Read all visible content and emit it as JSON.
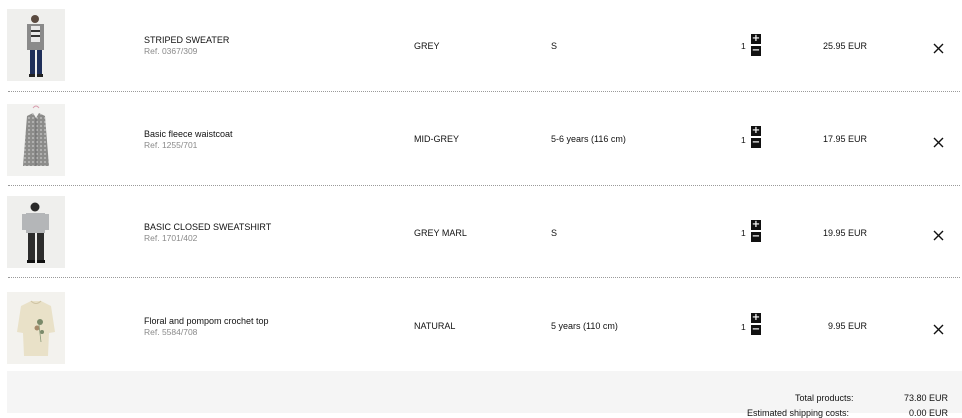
{
  "cart": {
    "items": [
      {
        "name": "STRIPED SWEATER",
        "ref": "Ref. 0367/309",
        "color": "GREY",
        "size": "S",
        "quantity": "1",
        "price": "25.95 EUR"
      },
      {
        "name": "Basic fleece waistcoat",
        "ref": "Ref. 1255/701",
        "color": "MID-GREY",
        "size": "5-6 years (116 cm)",
        "quantity": "1",
        "price": "17.95 EUR"
      },
      {
        "name": "BASIC CLOSED SWEATSHIRT",
        "ref": "Ref. 1701/402",
        "color": "GREY MARL",
        "size": "S",
        "quantity": "1",
        "price": "19.95 EUR"
      },
      {
        "name": "Floral and pompom crochet top",
        "ref": "Ref. 5584/708",
        "color": "NATURAL",
        "size": "5 years (110 cm)",
        "quantity": "1",
        "price": "9.95 EUR"
      }
    ],
    "stepper": {
      "plus": "+",
      "minus": "−"
    },
    "remove_icon": "close-icon"
  },
  "totals": {
    "products_label": "Total products:",
    "products_value": "73.80 EUR",
    "next_label_cut": "Estimated shipping costs:",
    "next_value_cut": "0.00 EUR"
  },
  "colors": {
    "accent": "#111111",
    "ref_text": "#8a8a8a",
    "totals_bg": "#f5f5f5"
  }
}
